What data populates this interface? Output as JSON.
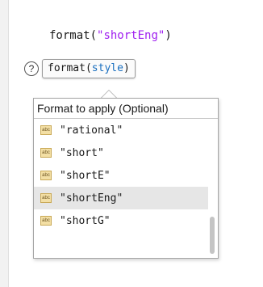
{
  "editor": {
    "code_fn": "format(",
    "code_arg": "\"shortEng\"",
    "code_close": ")"
  },
  "signature": {
    "help_glyph": "?",
    "fn": "format(",
    "param": "style",
    "close": ")"
  },
  "completion": {
    "header": "Format to apply (Optional)",
    "item_icon_text": "abc",
    "items": [
      {
        "label": "\"rational\"",
        "selected": false
      },
      {
        "label": "\"short\"",
        "selected": false
      },
      {
        "label": "\"shortE\"",
        "selected": false
      },
      {
        "label": "\"shortEng\"",
        "selected": true
      },
      {
        "label": "\"shortG\"",
        "selected": false
      }
    ]
  }
}
